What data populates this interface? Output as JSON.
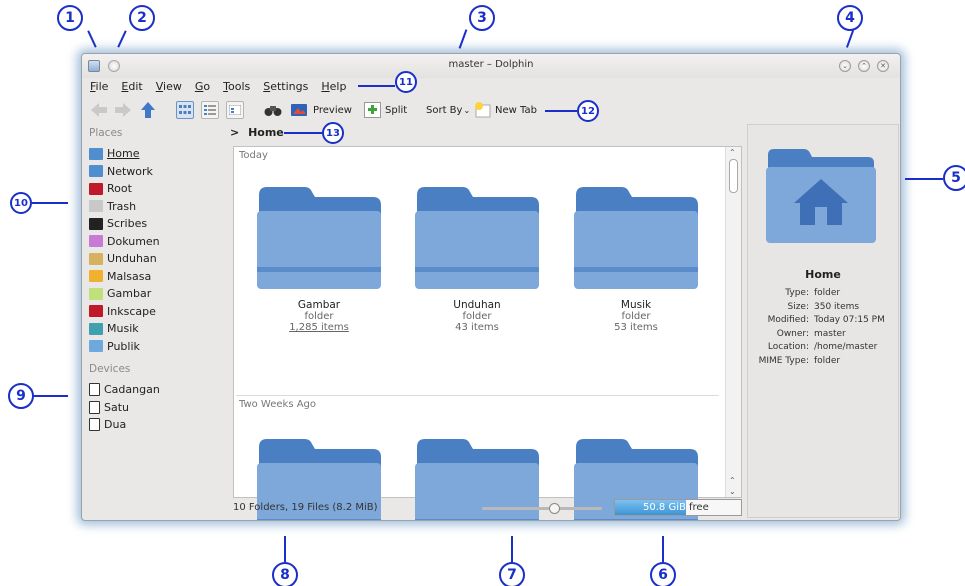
{
  "window": {
    "title": "master – Dolphin",
    "app_icon": "dolphin-app-icon",
    "buttons": [
      "minimize",
      "maximize",
      "close"
    ]
  },
  "menubar": [
    "File",
    "Edit",
    "View",
    "Go",
    "Tools",
    "Settings",
    "Help"
  ],
  "toolbar": {
    "preview_label": "Preview",
    "split_label": "Split",
    "sortby_label": "Sort By",
    "newtab_label": "New Tab"
  },
  "places": {
    "title": "Places",
    "items": [
      {
        "label": "Home",
        "icon": "home-folder-icon",
        "color": "#4f8fd0"
      },
      {
        "label": "Network",
        "icon": "network-icon",
        "color": "#4f8fd0"
      },
      {
        "label": "Root",
        "icon": "folder-red-icon",
        "color": "#c0192a"
      },
      {
        "label": "Trash",
        "icon": "trash-icon",
        "color": "#c8c8c8"
      },
      {
        "label": "Scribes",
        "icon": "folder-black-icon",
        "color": "#222222"
      },
      {
        "label": "Dokumen",
        "icon": "folder-violet-icon",
        "color": "#c77ad6"
      },
      {
        "label": "Unduhan",
        "icon": "folder-tan-icon",
        "color": "#d6b25e"
      },
      {
        "label": "Malsasa",
        "icon": "folder-orange-icon",
        "color": "#f0b030"
      },
      {
        "label": "Gambar",
        "icon": "folder-green-icon",
        "color": "#bfe07a"
      },
      {
        "label": "Inkscape",
        "icon": "folder-red-icon",
        "color": "#c0192a"
      },
      {
        "label": "Musik",
        "icon": "folder-teal-icon",
        "color": "#3fa0b0"
      },
      {
        "label": "Publik",
        "icon": "folder-blue-icon",
        "color": "#6fa8dc"
      }
    ]
  },
  "devices": {
    "title": "Devices",
    "items": [
      {
        "label": "Cadangan",
        "icon": "drive-icon"
      },
      {
        "label": "Satu",
        "icon": "drive-icon"
      },
      {
        "label": "Dua",
        "icon": "drive-icon"
      }
    ]
  },
  "location": {
    "label": "Home"
  },
  "groups": [
    {
      "label": "Today",
      "folders": [
        {
          "name": "Gambar",
          "type": "folder",
          "count": "1,285 items"
        },
        {
          "name": "Unduhan",
          "type": "folder",
          "count": "43 items"
        },
        {
          "name": "Musik",
          "type": "folder",
          "count": "53 items"
        }
      ]
    },
    {
      "label": "Two Weeks Ago",
      "folders": [
        {
          "name": "",
          "type": "",
          "count": ""
        },
        {
          "name": "",
          "type": "",
          "count": ""
        },
        {
          "name": "",
          "type": "",
          "count": ""
        }
      ]
    }
  ],
  "statusbar": {
    "summary": "10 Folders, 19 Files (8.2 MiB)",
    "zoom_level": 0.6,
    "free_space": "50.8 GiB",
    "free_label": "free",
    "used_fraction": 0.56
  },
  "info_panel": {
    "name": "Home",
    "rows": [
      {
        "k": "Type:",
        "v": "folder"
      },
      {
        "k": "Size:",
        "v": "350 items"
      },
      {
        "k": "Modified:",
        "v": "Today 07:15 PM"
      },
      {
        "k": "Owner:",
        "v": "master"
      },
      {
        "k": "Location:",
        "v": "/home/master"
      },
      {
        "k": "MIME Type:",
        "v": "folder"
      }
    ]
  },
  "callouts": [
    "1",
    "2",
    "3",
    "4",
    "5",
    "6",
    "7",
    "8",
    "9",
    "10",
    "11",
    "12",
    "13"
  ],
  "colors": {
    "callout": "#1a2fc9",
    "folder_top": "#4a7fc3",
    "folder_body": "#7fa8da",
    "window_glow": "#5a8cbe"
  }
}
